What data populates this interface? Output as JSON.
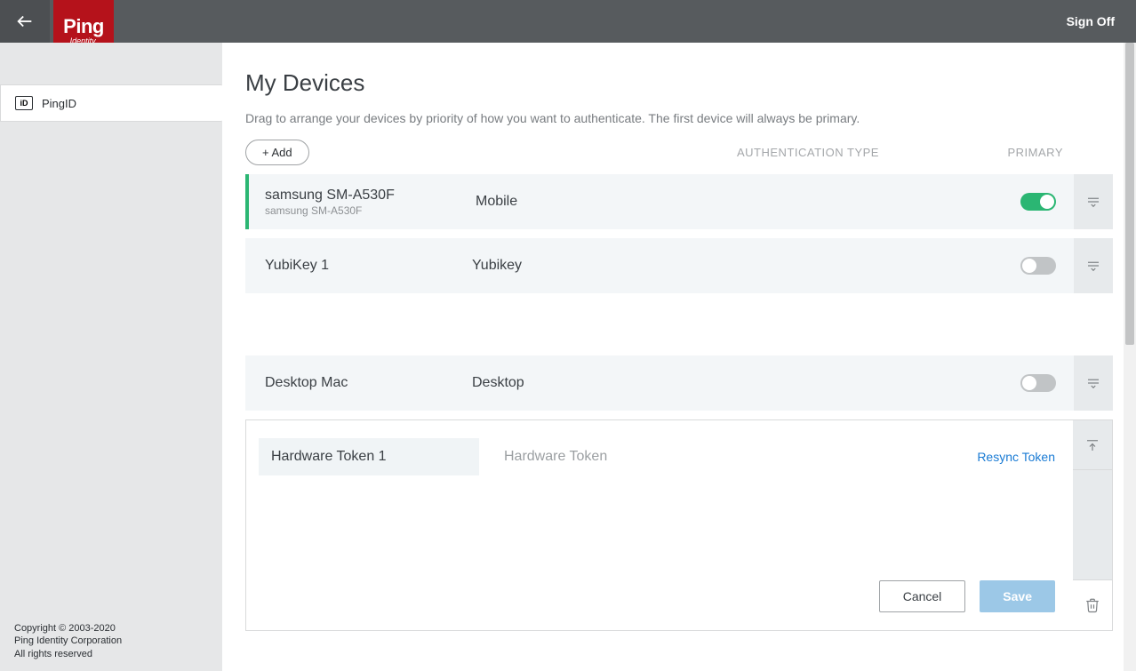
{
  "header": {
    "signoff": "Sign Off",
    "logo_main": "Ping",
    "logo_sub": "Identity."
  },
  "sidebar": {
    "items": [
      {
        "icon_label": "iD",
        "label": "PingID"
      }
    ],
    "copyright_line1": "Copyright © 2003-2020",
    "copyright_line2": "Ping Identity Corporation",
    "copyright_line3": "All rights reserved"
  },
  "main": {
    "title": "My Devices",
    "description": "Drag to arrange your devices by priority of how you want to authenticate. The first device will always be primary.",
    "add_label": "+ Add",
    "col_auth": "AUTHENTICATION TYPE",
    "col_primary": "PRIMARY",
    "devices": [
      {
        "name": "samsung SM-A530F",
        "sub": "samsung SM-A530F",
        "type": "Mobile",
        "primary": true
      },
      {
        "name": "YubiKey 1",
        "sub": "",
        "type": "Yubikey",
        "primary": false
      },
      {
        "name": "Desktop Mac",
        "sub": "",
        "type": "Desktop",
        "primary": false
      }
    ],
    "editor": {
      "name": "Hardware Token 1",
      "type": "Hardware Token",
      "resync": "Resync Token",
      "cancel": "Cancel",
      "save": "Save"
    }
  }
}
